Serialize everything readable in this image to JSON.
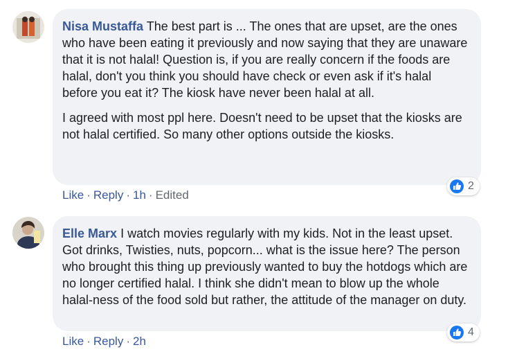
{
  "comments": [
    {
      "author": "Nisa Mustaffa",
      "paragraphs": [
        "The best part is ... The ones that are upset, are the ones who have been eating it previously and now saying that they are unaware that it is not halal! Question is, if you are really concern if the foods are halal, don't you think you should have check or even ask if it's halal before you eat it? The kiosk have never been halal at all.",
        "I agreed with most ppl here. Doesn't need to be upset that the kiosks are not halal certified. So many other options outside the kiosks."
      ],
      "actions": {
        "like": "Like",
        "reply": "Reply",
        "time": "1h",
        "edited": "Edited"
      },
      "reaction_count": "2",
      "avatar_icon": "profile-photo-icon"
    },
    {
      "author": "Elle Marx",
      "paragraphs": [
        "I watch movies regularly with my kids. Not in the least upset. Got drinks, Twisties, nuts, popcorn... what is the issue here? The person who brought this thing up previously wanted to buy the hotdogs which are no longer certified halal. I think she didn't mean to blow up the whole halal-ness of the food sold but rather, the attitude of the manager on duty."
      ],
      "actions": {
        "like": "Like",
        "reply": "Reply",
        "time": "2h"
      },
      "reaction_count": "4",
      "avatar_icon": "profile-photo-icon"
    }
  ],
  "colors": {
    "author": "#385898",
    "bubble": "#f0f2f5",
    "meta": "#606770",
    "like_blue": "#1877f2"
  }
}
